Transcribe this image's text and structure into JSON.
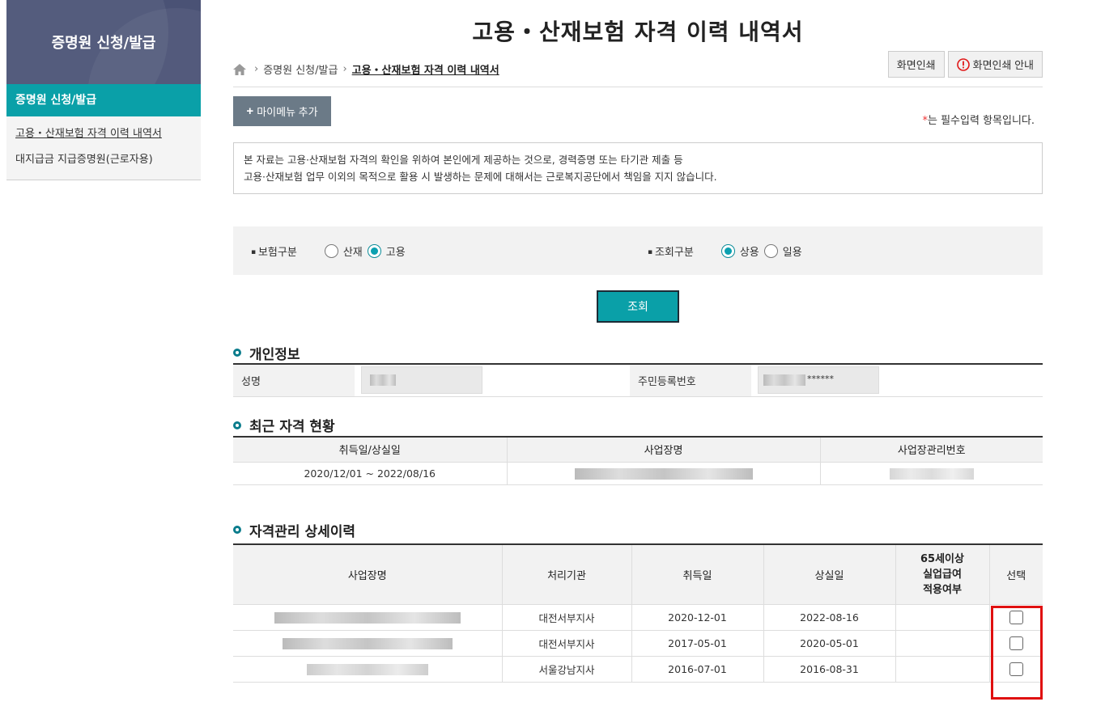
{
  "sidebar": {
    "title": "증명원 신청/발급",
    "active_section": "증명원 신청/발급",
    "items": [
      {
        "label": "고용・산재보험 자격 이력 내역서"
      },
      {
        "label": "대지급금 지급증명원(근로자용)"
      }
    ]
  },
  "page": {
    "title": "고용・산재보험 자격 이력 내역서"
  },
  "breadcrumb": [
    "증명원 신청/발급",
    "고용・산재보험 자격 이력 내역서"
  ],
  "toolbar": {
    "print_label": "화면인쇄",
    "print_guide_label": "화면인쇄 안내"
  },
  "mymenu": {
    "label": "마이메뉴 추가"
  },
  "required_note": {
    "star": "*",
    "text": "는 필수입력 항목입니다."
  },
  "notice": {
    "line1": "본 자료는 고용·산재보험 자격의 확인을 위하여 본인에게 제공하는 것으로, 경력증명 또는 타기관 제출 등",
    "line2": "고용·산재보험 업무 이외의 목적으로 활용 시 발생하는 문제에 대해서는 근로복지공단에서 책임을 지지 않습니다."
  },
  "filters": {
    "insurance": {
      "label": "보험구분",
      "options": [
        "산재",
        "고용"
      ],
      "selected": "고용"
    },
    "inquiry": {
      "label": "조회구분",
      "options": [
        "상용",
        "일용"
      ],
      "selected": "상용"
    }
  },
  "search_button": "조회",
  "personal": {
    "section_title": "개인정보",
    "name_label": "성명",
    "rrn_label": "주민등록번호",
    "rrn_suffix": "******"
  },
  "recent": {
    "section_title": "최근 자격 현황",
    "headers": [
      "취득일/상실일",
      "사업장명",
      "사업장관리번호"
    ],
    "period": "2020/12/01 ~ 2022/08/16"
  },
  "detail": {
    "section_title": "자격관리 상세이력",
    "headers": [
      "사업장명",
      "처리기관",
      "취득일",
      "상실일",
      "65세이상 실업급여 적용여부",
      "선택"
    ],
    "header_65_lines": [
      "65세이상",
      "실업급여",
      "적용여부"
    ],
    "rows": [
      {
        "office": "대전서부지사",
        "acquired": "2020-12-01",
        "lost": "2022-08-16"
      },
      {
        "office": "대전서부지사",
        "acquired": "2017-05-01",
        "lost": "2020-05-01"
      },
      {
        "office": "서울강남지사",
        "acquired": "2016-07-01",
        "lost": "2016-08-31"
      }
    ]
  },
  "colors": {
    "sidebar_header": "#4a5275",
    "accent": "#0aa0a8",
    "highlight_box": "#e01010"
  }
}
